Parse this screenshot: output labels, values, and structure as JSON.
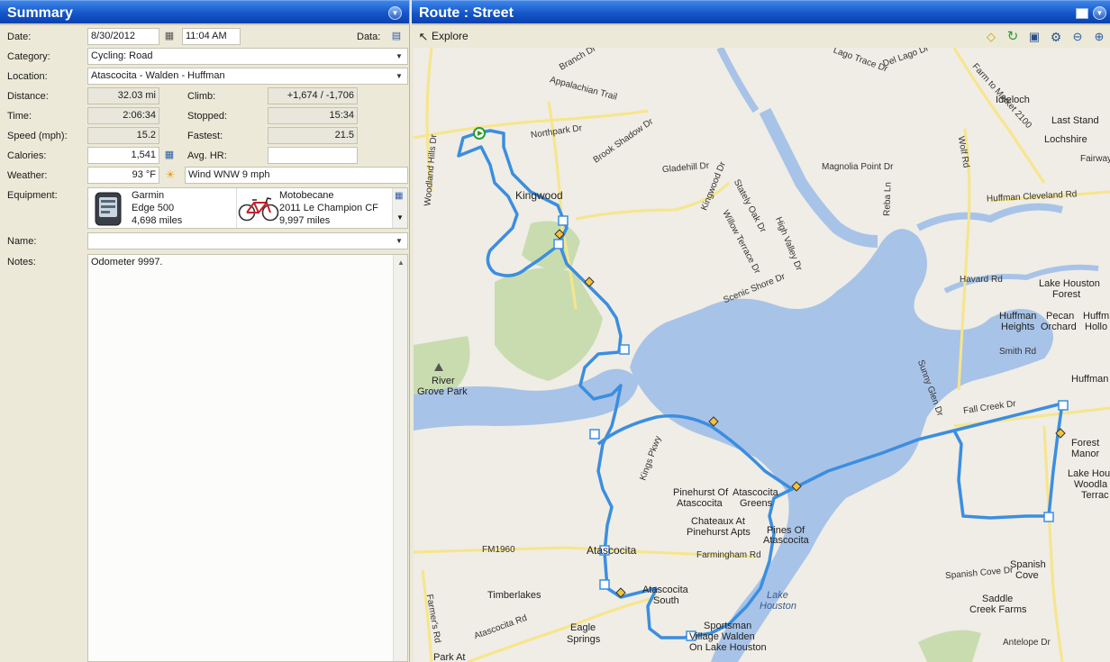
{
  "summary": {
    "title": "Summary",
    "date_label": "Date:",
    "date": "8/30/2012",
    "time_value": "11:04 AM",
    "data_label": "Data:",
    "category_label": "Category:",
    "category": "Cycling: Road",
    "location_label": "Location:",
    "location": "Atascocita - Walden - Huffman",
    "distance_label": "Distance:",
    "distance": "32.03 mi",
    "climb_label": "Climb:",
    "climb": "+1,674 / -1,706",
    "time_label": "Time:",
    "time": "2:06:34",
    "stopped_label": "Stopped:",
    "stopped": "15:34",
    "speed_label": "Speed (mph):",
    "speed": "15.2",
    "fastest_label": "Fastest:",
    "fastest": "21.5",
    "calories_label": "Calories:",
    "calories": "1,541",
    "avghr_label": "Avg. HR:",
    "avghr": "",
    "weather_label": "Weather:",
    "temperature": "93 °F",
    "weather": "Wind WNW 9 mph",
    "equipment_label": "Equipment:",
    "equipment": [
      {
        "line1": "Garmin",
        "line2": "Edge 500",
        "line3": "4,698 miles"
      },
      {
        "line1": "Motobecane",
        "line2": "2011 Le Champion CF",
        "line3": "9,997 miles"
      }
    ],
    "name_label": "Name:",
    "name": "",
    "notes_label": "Notes:",
    "notes": "Odometer 9997."
  },
  "route": {
    "title": "Route : Street",
    "explore_label": "Explore"
  },
  "map_labels": {
    "kingwood": "Kingwood",
    "atascocita": "Atascocita",
    "idleloch": "Idleloch",
    "last_stand": "Last Stand",
    "lochshire": "Lochshire",
    "fairway": "Fairway",
    "lake_houston_forest_1": "Lake Houston",
    "lake_houston_forest_2": "Forest",
    "huffman_heights_1": "Huffman",
    "huffman_heights_2": "Heights",
    "pecan_orchard_1": "Pecan",
    "pecan_orchard_2": "Orchard",
    "huffman_hollow_1": "Huffm",
    "huffman_hollow_2": "Hollo",
    "huffman": "Huffman",
    "forest_manor_1": "Forest",
    "forest_manor_2": "Manor",
    "lake_hou_1": "Lake Hou",
    "lake_hou_2": "Woodla",
    "lake_hou_3": "Terrac",
    "river_grove_1": "River",
    "river_grove_2": "Grove Park",
    "pinehurst_1": "Pinehurst Of",
    "pinehurst_2": "Atascocita",
    "atascocita_greens_1": "Atascocita",
    "atascocita_greens_2": "Greens",
    "chateaux_1": "Chateaux At",
    "chateaux_2": "Pinehurst Apts",
    "pines_1": "Pines Of",
    "pines_2": "Atascocita",
    "timberlakes": "Timberlakes",
    "atascocita_south_1": "Atascocita",
    "atascocita_south_2": "South",
    "lake_houston_1": "Lake",
    "lake_houston_2": "Houston",
    "eagle_springs_1": "Eagle",
    "eagle_springs_2": "Springs",
    "sportsman_1": "Sportsman",
    "sportsman_2": "Village Walden",
    "sportsman_3": "On Lake Houston",
    "spanish_cove_1": "Spanish",
    "spanish_cove_2": "Cove",
    "saddle_creek_1": "Saddle",
    "saddle_creek_2": "Creek Farms",
    "park_at": "Park At",
    "rd_northpark": "Northpark Dr",
    "rd_appalachian": "Appalachian Trail",
    "rd_brook_shadow": "Brook Shadow Dr",
    "rd_gladehill": "Gladehill Dr",
    "rd_kingwood": "Kingwood Dr",
    "rd_stately_oak": "Stately Oak Dr",
    "rd_willow": "Willow Terrace Dr",
    "rd_high_valley": "High Valley Dr",
    "rd_scenic": "Scenic Shore Dr",
    "rd_magnolia": "Magnolia Point Dr",
    "rd_havard": "Havard Rd",
    "rd_smith": "Smith Rd",
    "rd_huffman_cleveland": "Huffman Cleveland Rd",
    "rd_fm2100": "Farm to Market 2100",
    "rd_wolf": "Wolf Rd",
    "rd_fall_creek": "Fall Creek Dr",
    "rd_fm1960": "FM1960",
    "rd_farmingham": "Farmingham Rd",
    "rd_atascocita": "Atascocita Rd",
    "rd_farmers": "Farmer's Rd",
    "rd_kings_pkwy": "Kings Pkwy",
    "rd_woodland_hills": "Woodland Hills Dr",
    "rd_spanish_cove": "Spanish Cove Dr",
    "rd_antelope": "Antelope Dr",
    "rd_del_lago": "Del Lago Dr",
    "rd_lago_trace": "Lago Trace Dr",
    "rd_branch": "Branch Dr",
    "rd_sunny_glen": "Sunny Glen Dr",
    "rd_reba": "Reba Ln"
  }
}
